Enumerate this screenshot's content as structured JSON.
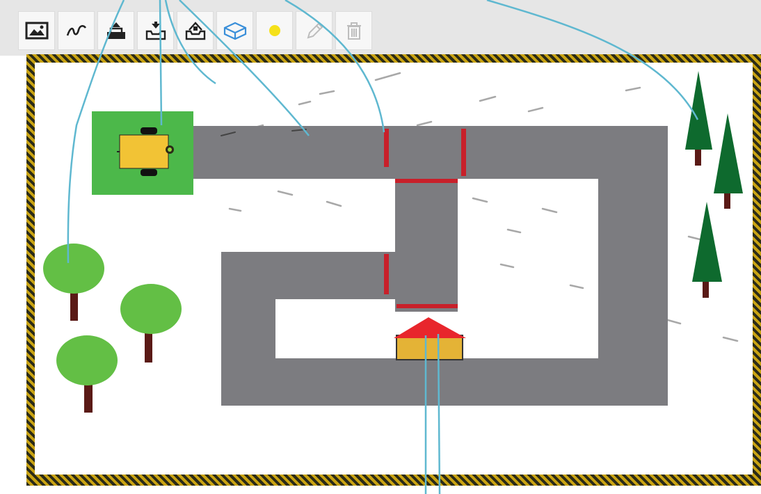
{
  "toolbar": {
    "tools": [
      {
        "name": "background-image-tool",
        "icon": "image-icon"
      },
      {
        "name": "draw-path-tool",
        "icon": "squiggle-icon"
      },
      {
        "name": "upload-tool",
        "icon": "tray-up-icon"
      },
      {
        "name": "download-tool",
        "icon": "tray-down-icon"
      },
      {
        "name": "import-tool",
        "icon": "tray-open-icon"
      },
      {
        "name": "obstacle-box-tool",
        "icon": "box-icon",
        "accent": "#3a8fd9"
      },
      {
        "name": "light-marker-tool",
        "icon": "yellow-dot-icon",
        "accent": "#f5e11a"
      },
      {
        "name": "pencil-tool",
        "icon": "pencil-icon",
        "disabled": true
      },
      {
        "name": "delete-tool",
        "icon": "trash-icon",
        "disabled": true
      }
    ]
  },
  "map": {
    "colors": {
      "road": "#7c7c80",
      "start_zone": "#4cb84a",
      "robot_body": "#f2c335",
      "red_line": "#c8202a",
      "house_roof": "#e8262c",
      "house_body": "#e4b336",
      "deciduous_leaf": "#63bf45",
      "conifer": "#0e6a2e",
      "trunk": "#5a1a16",
      "border_dark": "#2b2b18",
      "border_light": "#c9a312",
      "callout_line": "#5fb8d0"
    }
  }
}
